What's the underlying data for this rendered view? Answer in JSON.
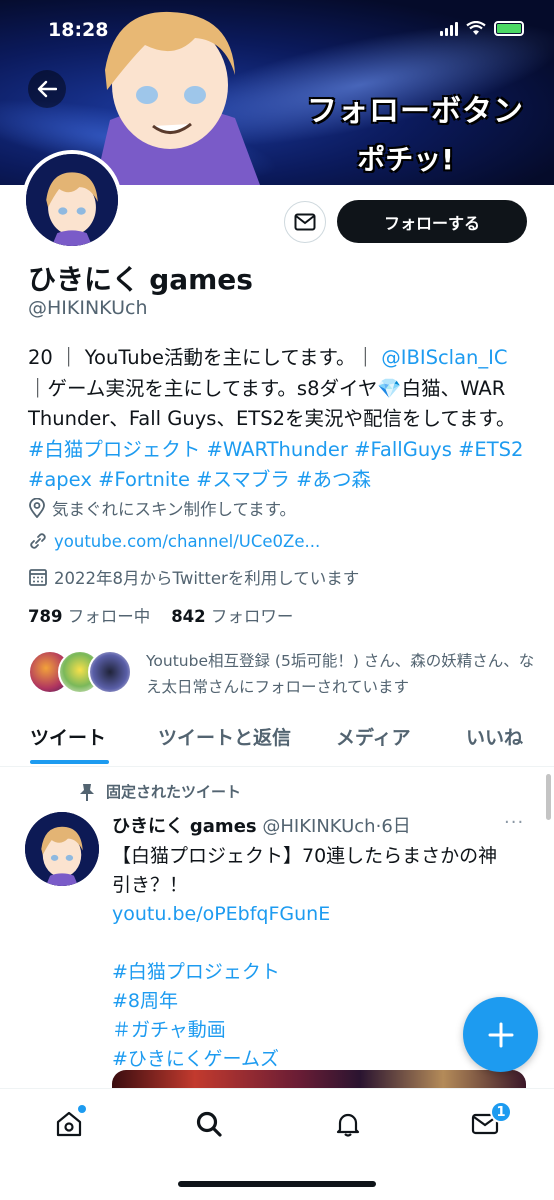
{
  "status_bar": {
    "time": "18:28"
  },
  "banner": {
    "caption_line1": "フォローボタン",
    "caption_line2": "ポチッ!"
  },
  "profile": {
    "name": "ひきにく games",
    "handle": "@HIKINKUch",
    "follow_label": "フォローする",
    "bio": {
      "p1": "20 ｜ YouTube活動を主にしてます。｜",
      "mention": "@IBISclan_IC",
      "p2": "｜ゲーム実況を主にしてます。s8ダイヤ",
      "diamond": "💎",
      "p3": "白猫、WAR Thunder、Fall Guys、ETS2を実況や配信をしてます。",
      "hashtags": [
        "#白猫プロジェクト",
        "#WARThunder",
        "#FallGuys",
        "#ETS2",
        "#apex",
        "#Fortnite",
        "#スマブラ",
        "#あつ森"
      ]
    },
    "location": "気まぐれにスキン制作してます。",
    "url": "youtube.com/channel/UCe0Ze...",
    "joined": "2022年8月からTwitterを利用しています",
    "following_count": "789",
    "following_label": "フォロー中",
    "followers_count": "842",
    "followers_label": "フォロワー",
    "followed_by": "Youtube相互登録 (5垢可能！) さん、森の妖精さん、なえ太日常さんにフォローされています"
  },
  "tabs": [
    "ツイート",
    "ツイートと返信",
    "メディア",
    "いいね"
  ],
  "active_tab": "ツイート",
  "tweet": {
    "pinned_label": "固定されたツイート",
    "author_name": "ひきにく games",
    "author_handle": "@HIKINKUch",
    "time": "·6日",
    "more": "···",
    "line1": "【白猫プロジェクト】70連したらまさかの神",
    "line2": "引き？！",
    "link": "youtu.be/oPEbfqFGunE",
    "tags": [
      "#白猫プロジェクト",
      "#8周年",
      " ＃ガチャ動画",
      " #ひきにくゲームズ"
    ]
  },
  "fab_icon": "plus-icon",
  "nav": {
    "items": [
      "home-icon",
      "search-icon",
      "notifications-icon",
      "messages-icon"
    ],
    "messages_badge": "1"
  },
  "colors": {
    "accent": "#1d9bf0",
    "text": "#0f1419",
    "secondary": "#536471"
  }
}
